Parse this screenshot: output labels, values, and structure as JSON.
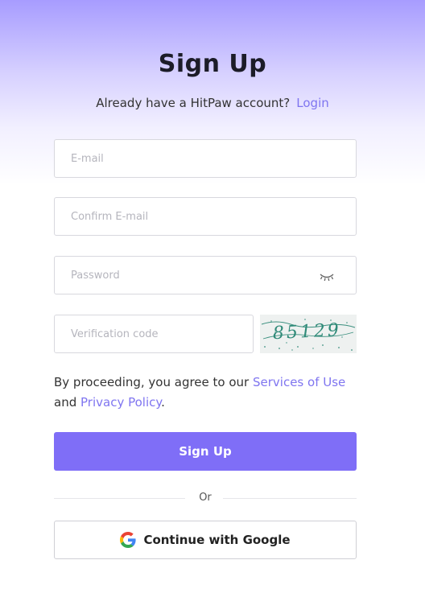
{
  "header": {
    "title": "Sign Up",
    "account_prompt": "Already have a HitPaw account?",
    "login_link": "Login"
  },
  "form": {
    "email_placeholder": "E-mail",
    "confirm_email_placeholder": "Confirm E-mail",
    "password_placeholder": "Password",
    "verification_placeholder": "Verification code",
    "captcha_text": "85129",
    "password_toggle_icon": "eye-closed-icon"
  },
  "consent": {
    "prefix": "By proceeding, you agree to our",
    "services_link": "Services of Use",
    "and_text": "and",
    "privacy_link": "Privacy Policy",
    "suffix": "."
  },
  "actions": {
    "signup_label": "Sign Up",
    "or_text": "Or",
    "google_label": "Continue with Google",
    "google_icon": "google-icon"
  },
  "colors": {
    "accent": "#7f6ef7",
    "link": "#7f75f0",
    "header_gradient_top": "#a79cff"
  }
}
